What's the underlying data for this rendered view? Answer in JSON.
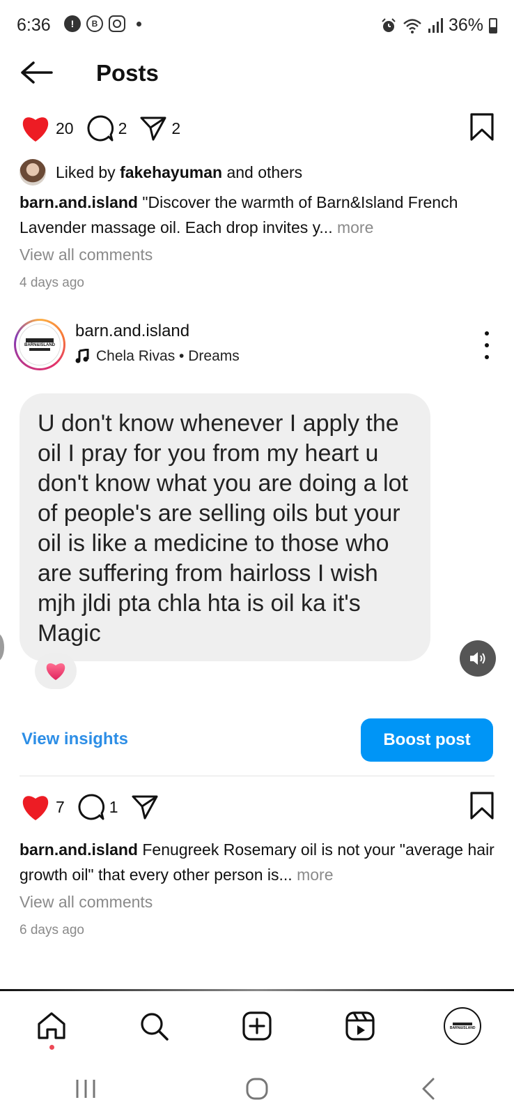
{
  "status_bar": {
    "time": "6:36",
    "battery": "36%",
    "left_icons": [
      "alert-icon",
      "b-icon",
      "instagram-icon",
      "dot-icon"
    ],
    "right_icons": [
      "alarm-icon",
      "wifi-icon",
      "signal-icon",
      "battery-icon"
    ]
  },
  "header": {
    "title": "Posts"
  },
  "post1": {
    "likes": "20",
    "comments": "2",
    "shares": "2",
    "liked_by_prefix": "Liked by ",
    "liked_by_user": "fakehayuman",
    "liked_by_suffix": " and others",
    "caption_user": "barn.and.island",
    "caption_text": " \"Discover the warmth of Barn&Island French Lavender massage oil. Each drop invites y...",
    "more": " more",
    "view_comments": "View all comments",
    "time_ago": "4 days ago"
  },
  "post2": {
    "username": "barn.and.island",
    "logo_text": "BARN&ISLAND",
    "music": "Chela Rivas • Dreams",
    "comment_text": "U don't know whenever I apply the oil I pray for you from my heart u don't know what you are doing a lot of people's are selling oils but your oil is like a medicine to those who are suffering from hairloss I wish mjh jldi pta chla hta is oil ka it's Magic",
    "view_insights": "View insights",
    "boost": "Boost post",
    "likes": "7",
    "comments": "1",
    "caption_user": "barn.and.island",
    "caption_text": " Fenugreek Rosemary oil is not your \"average hair growth oil\" that every other person is...",
    "more": " more",
    "view_comments": "View all comments",
    "time_ago": "6 days ago"
  },
  "bottom_nav": [
    "home-icon",
    "search-icon",
    "create-icon",
    "reels-icon",
    "profile-avatar"
  ],
  "system_nav": [
    "recent-apps-icon",
    "home-button-icon",
    "back-icon"
  ],
  "colors": {
    "like_red": "#ed1c24",
    "boost_blue": "#0095f6",
    "link_blue": "#2d8ee6",
    "muted_gray": "#8a8a8a"
  }
}
